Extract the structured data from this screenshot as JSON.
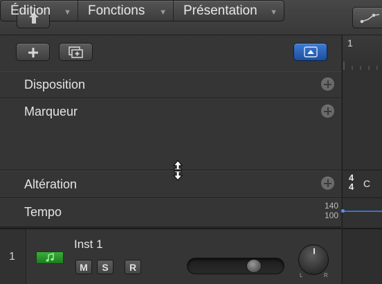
{
  "menubar": {
    "items": [
      {
        "label": "Édition"
      },
      {
        "label": "Fonctions"
      },
      {
        "label": "Présentation"
      }
    ]
  },
  "global_tracks": {
    "rows": [
      {
        "label": "Disposition"
      },
      {
        "label": "Marqueur"
      },
      {
        "label": "Altération"
      },
      {
        "label": "Tempo"
      }
    ],
    "tempo_high": "140",
    "tempo_low": "100"
  },
  "ruler": {
    "bar_number": "1",
    "time_sig_top": "4",
    "time_sig_bottom": "4",
    "key": "C"
  },
  "track": {
    "number": "1",
    "name": "Inst 1",
    "mute": "M",
    "solo": "S",
    "record": "R",
    "pan_left": "L",
    "pan_right": "R"
  },
  "colors": {
    "accent_blue": "#2a62b8",
    "instrument_green": "#2e8f2e",
    "tempo_line": "#3a72c8"
  }
}
